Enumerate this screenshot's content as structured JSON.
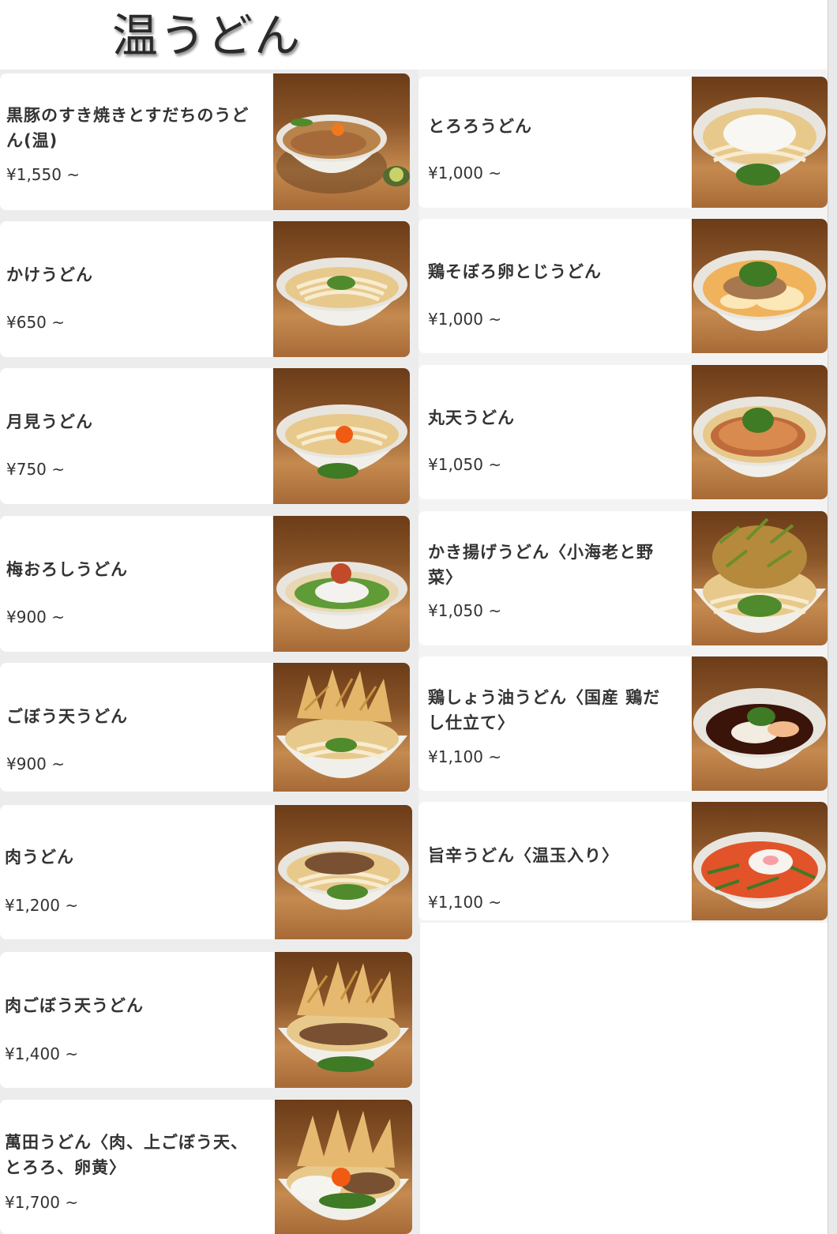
{
  "page": {
    "title": "温うどん"
  },
  "menu": {
    "left": [
      {
        "name": "黒豚のすき焼きとすだちのうどん(温)",
        "price": "¥1,550 ~",
        "image": "sukiyaki-udon-photo"
      },
      {
        "name": "かけうどん",
        "price": "¥650 ~",
        "image": "kake-udon-photo"
      },
      {
        "name": "月見うどん",
        "price": "¥750 ~",
        "image": "tsukimi-udon-photo"
      },
      {
        "name": "梅おろしうどん",
        "price": "¥900 ~",
        "image": "ume-oroshi-udon-photo"
      },
      {
        "name": "ごぼう天うどん",
        "price": "¥900 ~",
        "image": "gobou-ten-udon-photo"
      },
      {
        "name": "肉うどん",
        "price": "¥1,200 ~",
        "image": "niku-udon-photo"
      },
      {
        "name": "肉ごぼう天うどん",
        "price": "¥1,400 ~",
        "image": "niku-gobou-ten-udon-photo"
      },
      {
        "name": "萬田うどん〈肉、上ごぼう天、とろろ、卵黄〉",
        "price": "¥1,700 ~",
        "image": "manda-udon-photo"
      }
    ],
    "right": [
      {
        "name": "とろろうどん",
        "price": "¥1,000 ~",
        "image": "tororo-udon-photo"
      },
      {
        "name": "鶏そぼろ卵とじうどん",
        "price": "¥1,000 ~",
        "image": "tori-soboro-udon-photo"
      },
      {
        "name": "丸天うどん",
        "price": "¥1,050 ~",
        "image": "maruten-udon-photo"
      },
      {
        "name": "かき揚げうどん〈小海老と野菜〉",
        "price": "¥1,050 ~",
        "image": "kakiage-udon-photo"
      },
      {
        "name": "鶏しょう油うどん〈国産 鶏だし仕立て〉",
        "price": "¥1,100 ~",
        "image": "tori-shoyu-udon-photo"
      },
      {
        "name": "旨辛うどん〈温玉入り〉",
        "price": "¥1,100 ~",
        "image": "umakara-udon-photo"
      }
    ]
  },
  "colors": {
    "card_background": "#ffffff",
    "page_background": "#ececec",
    "text": "#333333",
    "broth": "#e9c98a",
    "bowl": "#f4f2ee",
    "wood": "#8a5428"
  }
}
